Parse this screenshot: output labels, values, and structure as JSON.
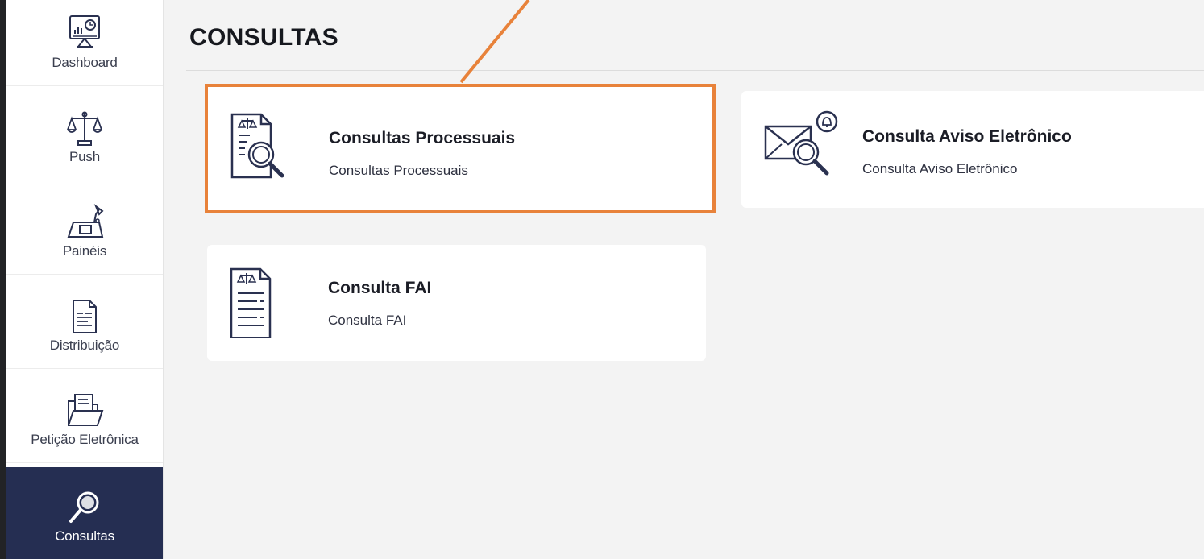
{
  "sidebar": {
    "items": [
      {
        "label": "Dashboard",
        "icon": "dashboard-monitor-icon"
      },
      {
        "label": "Push",
        "icon": "scales-icon"
      },
      {
        "label": "Painéis",
        "icon": "panel-desk-icon"
      },
      {
        "label": "Distribuição",
        "icon": "document-icon"
      },
      {
        "label": "Petição Eletrônica",
        "icon": "folder-document-icon"
      },
      {
        "label": "Consultas",
        "icon": "magnifier-icon",
        "active": true
      }
    ]
  },
  "page": {
    "title": "CONSULTAS"
  },
  "cards": [
    {
      "title": "Consultas Processuais",
      "subtitle": "Consultas Processuais",
      "icon": "document-search-icon",
      "highlighted": true
    },
    {
      "title": "Consulta Aviso Eletrônico",
      "subtitle": "Consulta Aviso Eletrônico",
      "icon": "envelope-bell-search-icon"
    },
    {
      "title": "Consulta FAI",
      "subtitle": "Consulta FAI",
      "icon": "document-list-icon"
    }
  ],
  "colors": {
    "sidebar_active": "#252e52",
    "highlight_border": "#e8823a",
    "annotation_line": "#e8823a",
    "icon_stroke": "#2a3150"
  }
}
